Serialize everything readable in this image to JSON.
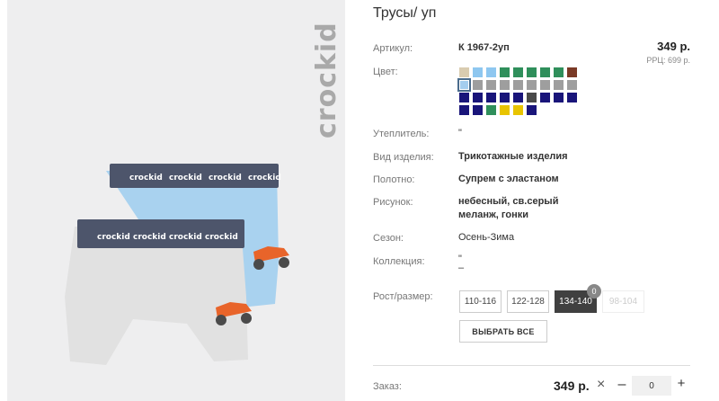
{
  "product": {
    "title": "Трусы/ уп",
    "brand_text": "crockid",
    "waistband_text": "crockid"
  },
  "details": {
    "sku_label": "Артикул:",
    "sku_value": "К 1967-2уп",
    "price": "349 р.",
    "rrp": "РРЦ: 699 р.",
    "color_label": "Цвет:",
    "insulation_label": "Утеплитель:",
    "insulation_value": "\"",
    "type_label": "Вид изделия:",
    "type_value": "Трикотажные изделия",
    "fabric_label": "Полотно:",
    "fabric_value": "Супрем с эластаном",
    "pattern_label": "Рисунок:",
    "pattern_line1": "небесный, св.серый",
    "pattern_line2": "меланж, гонки",
    "season_label": "Сезон:",
    "season_value": "Осень-Зима",
    "collection_label": "Коллекция:",
    "collection_line1": "\"",
    "collection_line2": "–",
    "size_label": "Рост/размер:"
  },
  "swatch_rows": [
    [
      "#d9ccb0",
      "#8ec7f0",
      "#8ec7f0",
      "#2f8f5b",
      "#2f8f5b",
      "#2f8f5b",
      "#2f8f5b",
      "#2f8f5b",
      "#7a3a26"
    ],
    [
      "#a4cdee",
      "#9e9e9e",
      "#9e9e9e",
      "#9e9e9e",
      "#9e9e9e",
      "#9e9e9e",
      "#9e9e9e",
      "#9e9e9e",
      "#9e9e9e"
    ],
    [
      "#19157a",
      "#19157a",
      "#19157a",
      "#19157a",
      "#19157a",
      "#4a4a4a",
      "#19157a",
      "#19157a",
      "#19157a"
    ],
    [
      "#19157a",
      "#19157a",
      "#2f8f5b",
      "#e8c400",
      "#e8c400",
      "#19157a"
    ]
  ],
  "sizes": [
    {
      "label": "110-116",
      "state": "normal"
    },
    {
      "label": "122-128",
      "state": "normal"
    },
    {
      "label": "134-140",
      "state": "active",
      "badge": "0"
    },
    {
      "label": "98-104",
      "state": "disabled"
    }
  ],
  "select_all_label": "ВЫБРАТЬ ВСЕ",
  "order": {
    "label": "Заказ:",
    "price": "349 р.",
    "times": "×",
    "minus": "–",
    "quantity": "0",
    "plus": "+"
  },
  "colors": {
    "image_bg": "#eeeeef",
    "blue_briefs": "#a9d2ef",
    "grey_briefs": "#e1e1e1",
    "waistband": "#4d556b",
    "truck_orange": "#e8642a"
  }
}
